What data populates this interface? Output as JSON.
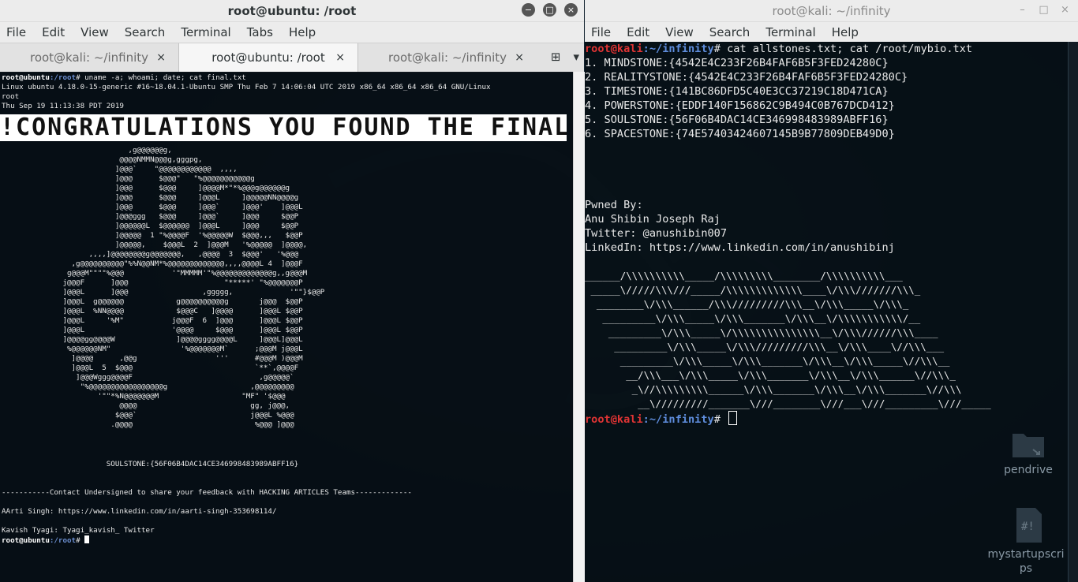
{
  "left_window": {
    "title": "root@ubuntu: /root",
    "buttons": {
      "minimize": "−",
      "maximize": "□",
      "close": "×"
    },
    "menu": [
      "File",
      "Edit",
      "View",
      "Search",
      "Terminal",
      "Tabs",
      "Help"
    ],
    "tabs": [
      {
        "label": "root@kali: ~/infinity",
        "close": "×"
      },
      {
        "label": "root@ubuntu: /root",
        "close": "×"
      },
      {
        "label": "root@kali: ~/infinity",
        "close": "×"
      }
    ],
    "tab_tools": {
      "new_tab": "⊞",
      "dropdown": "▾"
    },
    "terminal": {
      "prompt_user": "root@ubuntu",
      "prompt_path": ":/root",
      "command": "# uname -a; whoami; date; cat final.txt",
      "uname_output": "Linux ubuntu 4.18.0-15-generic #16~18.04.1-Ubuntu SMP Thu Feb 7 14:06:04 UTC 2019 x86_64 x86_64 x86_64 GNU/Linux",
      "whoami_output": "root",
      "date_output": "Thu Sep 19 11:13:38 PDT 2019",
      "banner": "!CONGRATULATIONS YOU FOUND THE FINAL FLAG !!",
      "ascii_art": "                             ,g@@@@@@g,\n                           @@@@NMMN@@@g,gggpg,\n                          ]@@@`    \"@@@@@@@@@@@@  ,,,,\n                          ]@@@      $@@@\"   \"%@@@@@@@@@@@g\n                          ]@@@      $@@@     ]@@@@M*\"*%@@@g@@@@@@g\n                          ]@@@      $@@@     ]@@@L     ]@@@@@NN@@@@g\n                          ]@@@      $@@@     ]@@@`     ]@@@'    ]@@@L\n                          ]@@@ggg   $@@@     ]@@@`     ]@@@     $@@P\n                          ]@@@@@@L  $@@@@@@  ]@@@L     ]@@@     $@@P\n                          ]@@@@@  1 \"%@@@@F  '%@@@@@W  $@@@,,,   $@@P\n                          ]@@@@@,    $@@@L  2  ]@@@M   '%@@@@@  ]@@@@,\n                    ,,,,]@@@@@@@@g@@@@@@@,   ,@@@@  3  $@@@'   '%@@@\n                ,g@@@@@@@@@@\"%%N@@NM*%@@@@@@@@@@@@@,,,,@@@@L 4  ]@@@F\n               g@@@M\"\"\"\"%@@@           '\"MMMMM'\"%@@@@@@@@@@@@@g,,g@@@M\n              j@@@F      ]@@@                      \"*****' \"%@@@@@@@P\n              ]@@@L      ]@@@                 ,ggggg,             '\"\"}$@@P\n              ]@@@L  g@@@@@@            g@@@@@@@@@@g       j@@@  $@@P\n              ]@@@L  %NN@@@@            $@@@C   ]@@@@      ]@@@L $@@P\n              ]@@@L     '%M\"           j@@@F  6  ]@@@      ]@@@L $@@P\n              ]@@@L                    '@@@@     $@@@      ]@@@L $@@P\n              ]@@@@gg@@@@W              ]@@@@gggg@@@@L     ]@@@L]@@@L\n               %@@@@@@NM\"                '%@@@@@@@M`      ;@@@M j@@@L\n                ]@@@@      ,@@g                  '''      #@@@M )@@@M\n                ]@@@L  5  $@@@                            `**`,@@@@F\n                 ]@@@Wggg@@@@F                             ,g@@@@@`\n                  \"%@@@@@@@@@@@@@@@@@g                   ,@@@@@@@@@\n                      '\"\"*%N@@@@@@@M                   \"MF\" '$@@@\n                           @@@@                          gg, j@@@,\n                          $@@@`                          j@@@L %@@@\n                         .@@@@                            %@@@ ]@@@",
      "soulstone_line": "                        SOULSTONE:{56F06B4DAC14CE346998483989ABFF16}",
      "contact_line": "-----------Contact Undersigned to share your feedback with HACKING ARTICLES Teams-------------",
      "aarti_line": "AArti Singh: https://www.linkedin.com/in/aarti-singh-353698114/",
      "kavish_line": "Kavish Tyagi: Tyagi_kavish_ Twitter",
      "final_prompt_user": "root@ubuntu",
      "final_prompt_path": ":/root",
      "final_prompt_end": "# "
    }
  },
  "right_window": {
    "title": "root@kali: ~/infinity",
    "buttons": {
      "minimize": "–",
      "maximize": "□",
      "close": "×"
    },
    "menu": [
      "File",
      "Edit",
      "View",
      "Search",
      "Terminal",
      "Help"
    ],
    "terminal": {
      "prompt_user": "root@kali",
      "prompt_path": ":~/infinity",
      "command": "# cat allstones.txt; cat /root/mybio.txt",
      "stones": [
        "1. MINDSTONE:{4542E4C233F26B4FAF6B5F3FED24280C}",
        "2. REALITYSTONE:{4542E4C233F26B4FAF6B5F3FED24280C}",
        "3. TIMESTONE:{141BC86DFD5C40E3CC37219C18D471CA}",
        "4. POWERSTONE:{EDDF140F156862C9B494C0B767DCD412}",
        "5. SOULSTONE:{56F06B4DAC14CE346998483989ABFF16}",
        "6. SPACESTONE:{74E57403424607145B9B77809DEB49D0}"
      ],
      "bio": [
        "Pwned By:",
        "Anu Shibin Joseph Raj",
        "Twitter: @anushibin007",
        "LinkedIn: https://www.linkedin.com/in/anushibinj"
      ],
      "ascii_art": "______/\\\\\\\\\\\\\\\\\\\\_____/\\\\\\\\\\\\\\\\\\________/\\\\\\\\\\\\\\\\\\\\___\n _____\\/////\\\\\\///_____/\\\\\\\\\\\\\\\\\\\\\\\\\\____\\/\\\\\\///////\\\\\\_\n  ________\\/\\\\\\______/\\\\\\/////////\\\\\\__\\/\\\\\\_____\\/\\\\\\_\n   _________\\/\\\\\\_____\\/\\\\\\_______\\/\\\\\\__\\/\\\\\\\\\\\\\\\\\\\\\\/__\n    _________\\/\\\\\\_____\\/\\\\\\\\\\\\\\\\\\\\\\\\\\\\\\__\\/\\\\\\//////\\\\\\____\n     _________\\/\\\\\\_____\\/\\\\\\/////////\\\\\\__\\/\\\\\\____\\//\\\\\\___\n      _________\\/\\\\\\_____\\/\\\\\\_______\\/\\\\\\__\\/\\\\\\_____\\//\\\\\\__\n       __/\\\\\\___\\/\\\\\\_____\\/\\\\\\_______\\/\\\\\\__\\/\\\\\\______\\//\\\\\\_\n        _\\//\\\\\\\\\\\\\\\\\\______\\/\\\\\\_______\\/\\\\\\__\\/\\\\\\_______\\//\\\\\\\n         __\\/////////_______\\///________\\///___\\///_________\\///_____",
      "final_prompt_user": "root@kali",
      "final_prompt_path": ":~/infinity",
      "final_prompt_end": "# "
    }
  },
  "desktop": {
    "icons": [
      {
        "label": "pendrive",
        "icon": "folder-icon"
      },
      {
        "label": "mystartupscrips",
        "icon": "script-icon"
      }
    ]
  }
}
